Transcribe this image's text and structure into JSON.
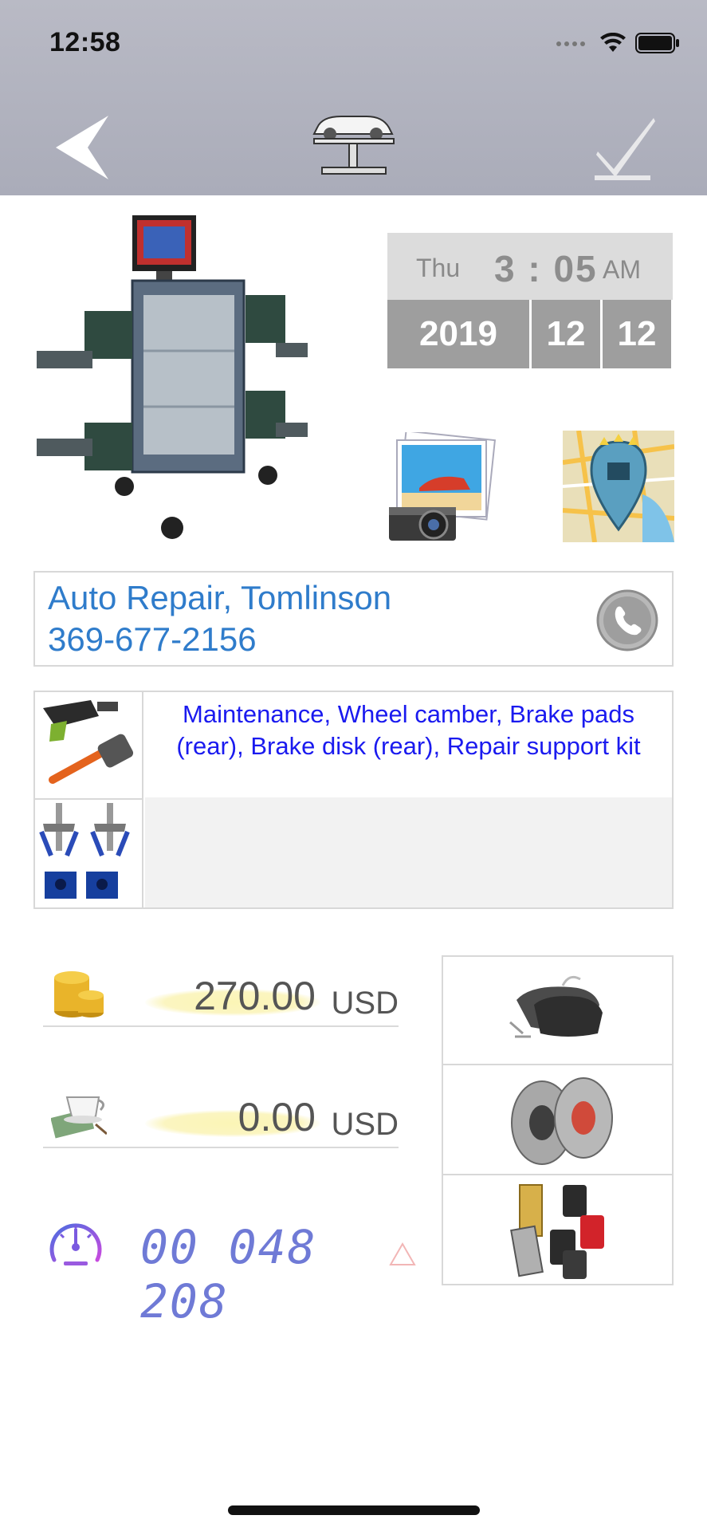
{
  "status_bar": {
    "time": "12:58"
  },
  "datetime": {
    "weekday": "Thu",
    "time": "3 : 05",
    "ampm": "AM",
    "year": "2019",
    "month": "12",
    "day": "12"
  },
  "contact": {
    "name": "Auto Repair, Tomlinson",
    "phone": "369-677-2156"
  },
  "service": {
    "description": "Maintenance, Wheel camber, Brake pads (rear), Brake disk (rear), Repair support kit"
  },
  "costs": [
    {
      "value": "270.00",
      "unit": "USD",
      "icon": "coins-icon"
    },
    {
      "value": "0.00",
      "unit": "USD",
      "icon": "tip-cup-icon"
    }
  ],
  "odometer": {
    "value": "00 048 208"
  },
  "parts": [
    {
      "icon": "brake-pads-icon"
    },
    {
      "icon": "brake-disks-icon"
    },
    {
      "icon": "repair-kit-icon"
    }
  ],
  "colors": {
    "accent_blue": "#2f7ccb",
    "service_text": "#1a1aef",
    "odometer": "#6f7ad6",
    "topbar": "#b0b2be"
  }
}
